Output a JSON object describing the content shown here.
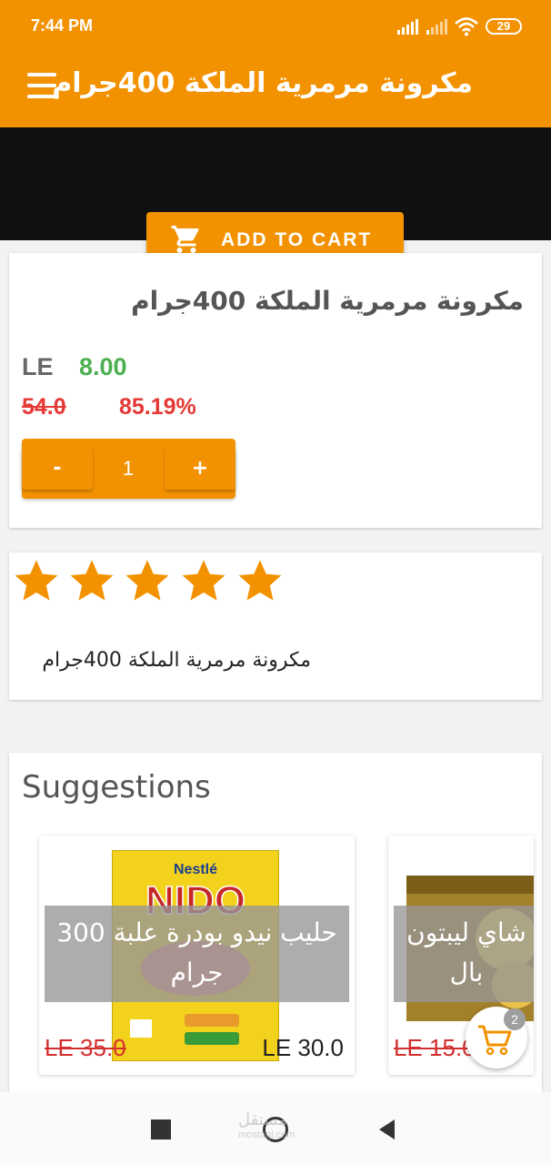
{
  "status_bar": {
    "time": "7:44 PM",
    "battery": "29"
  },
  "app_bar": {
    "title": "مكرونة مرمرية الملكة 400جرام"
  },
  "add_to_cart": {
    "label": "ADD TO CART"
  },
  "product": {
    "name": "مكرونة مرمرية الملكة 400جرام",
    "currency": "LE",
    "price": "8.00",
    "old_price": "54.0",
    "discount": "85.19%",
    "quantity": "1",
    "minus_label": "-",
    "plus_label": "+"
  },
  "rating": {
    "stars": 5,
    "max": 5,
    "color": "#f39200"
  },
  "description": {
    "text": "مكرونة مرمرية الملكة 400جرام"
  },
  "suggestions": {
    "title": "Suggestions",
    "items": [
      {
        "name": "حليب نيدو بودرة علبة 300 جرام",
        "old_price": "LE 35.0",
        "price": "LE 30.0"
      },
      {
        "name": "شاي ليبتون بال",
        "old_price": "LE 15.0",
        "price": ""
      }
    ]
  },
  "cart_fab": {
    "count": "2"
  },
  "colors": {
    "primary": "#f39200",
    "price_green": "#4caf50",
    "discount_red": "#e53935"
  },
  "watermark": {
    "text": "مستقل",
    "sub": "mostaql.com"
  }
}
